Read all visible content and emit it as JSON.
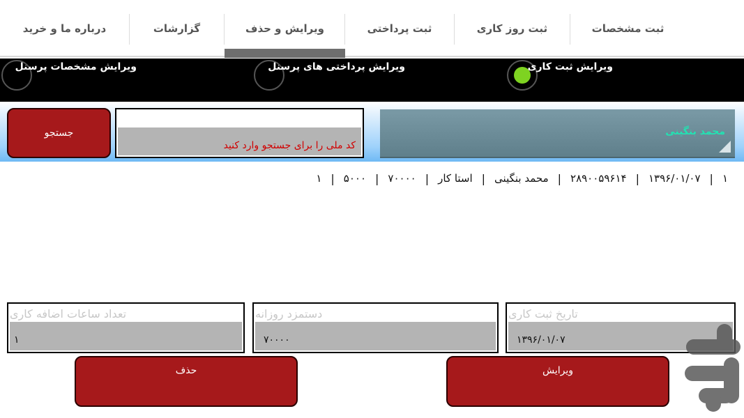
{
  "tabs": [
    {
      "label": "ثبت مشخصات",
      "selected": false
    },
    {
      "label": "ثبت روز کاری",
      "selected": false
    },
    {
      "label": "ثبت پرداختی",
      "selected": false
    },
    {
      "label": "ویرایش و حذف",
      "selected": true
    },
    {
      "label": "گزارشات",
      "selected": false
    },
    {
      "label": "درباره ما و خرید",
      "selected": false
    }
  ],
  "edit_modes": [
    {
      "label": "ویرایش ثبت کاری",
      "selected": true
    },
    {
      "label": "ویرایش پرداختی های پرسنل",
      "selected": false
    },
    {
      "label": "ویرایش مشخصات پرسنل",
      "selected": false
    }
  ],
  "search": {
    "button_label": "جستجو",
    "placeholder": "کد ملی را برای جستجو وارد کنید",
    "value": ""
  },
  "person_select": {
    "selected": "محمد  بنگینی"
  },
  "record_row": [
    "۱",
    "۱۳۹۶/۰۱/۰۷",
    "۲۸۹۰۰۵۹۶۱۴",
    "محمد بنگینی",
    "استا کار",
    "۷۰۰۰۰",
    "۵۰۰۰",
    "۱"
  ],
  "fields": {
    "date": {
      "label": "تاریخ ثبت کاری",
      "value": "۱۳۹۶/۰۱/۰۷"
    },
    "daily_wage": {
      "label": "دستمزد روزانه",
      "value": "۷۰۰۰۰"
    },
    "overtime": {
      "label": "تعداد ساعات اضافه کاری",
      "value": "۱"
    }
  },
  "actions": {
    "edit_label": "ویرایش",
    "delete_label": "حذف"
  },
  "colors": {
    "accent_red": "#a6191b",
    "radio_selected": "#7ed321",
    "person_name": "#22e2b2",
    "placeholder_red": "#d10000"
  },
  "watermark_icon": "cafebazaar-logo-icon"
}
